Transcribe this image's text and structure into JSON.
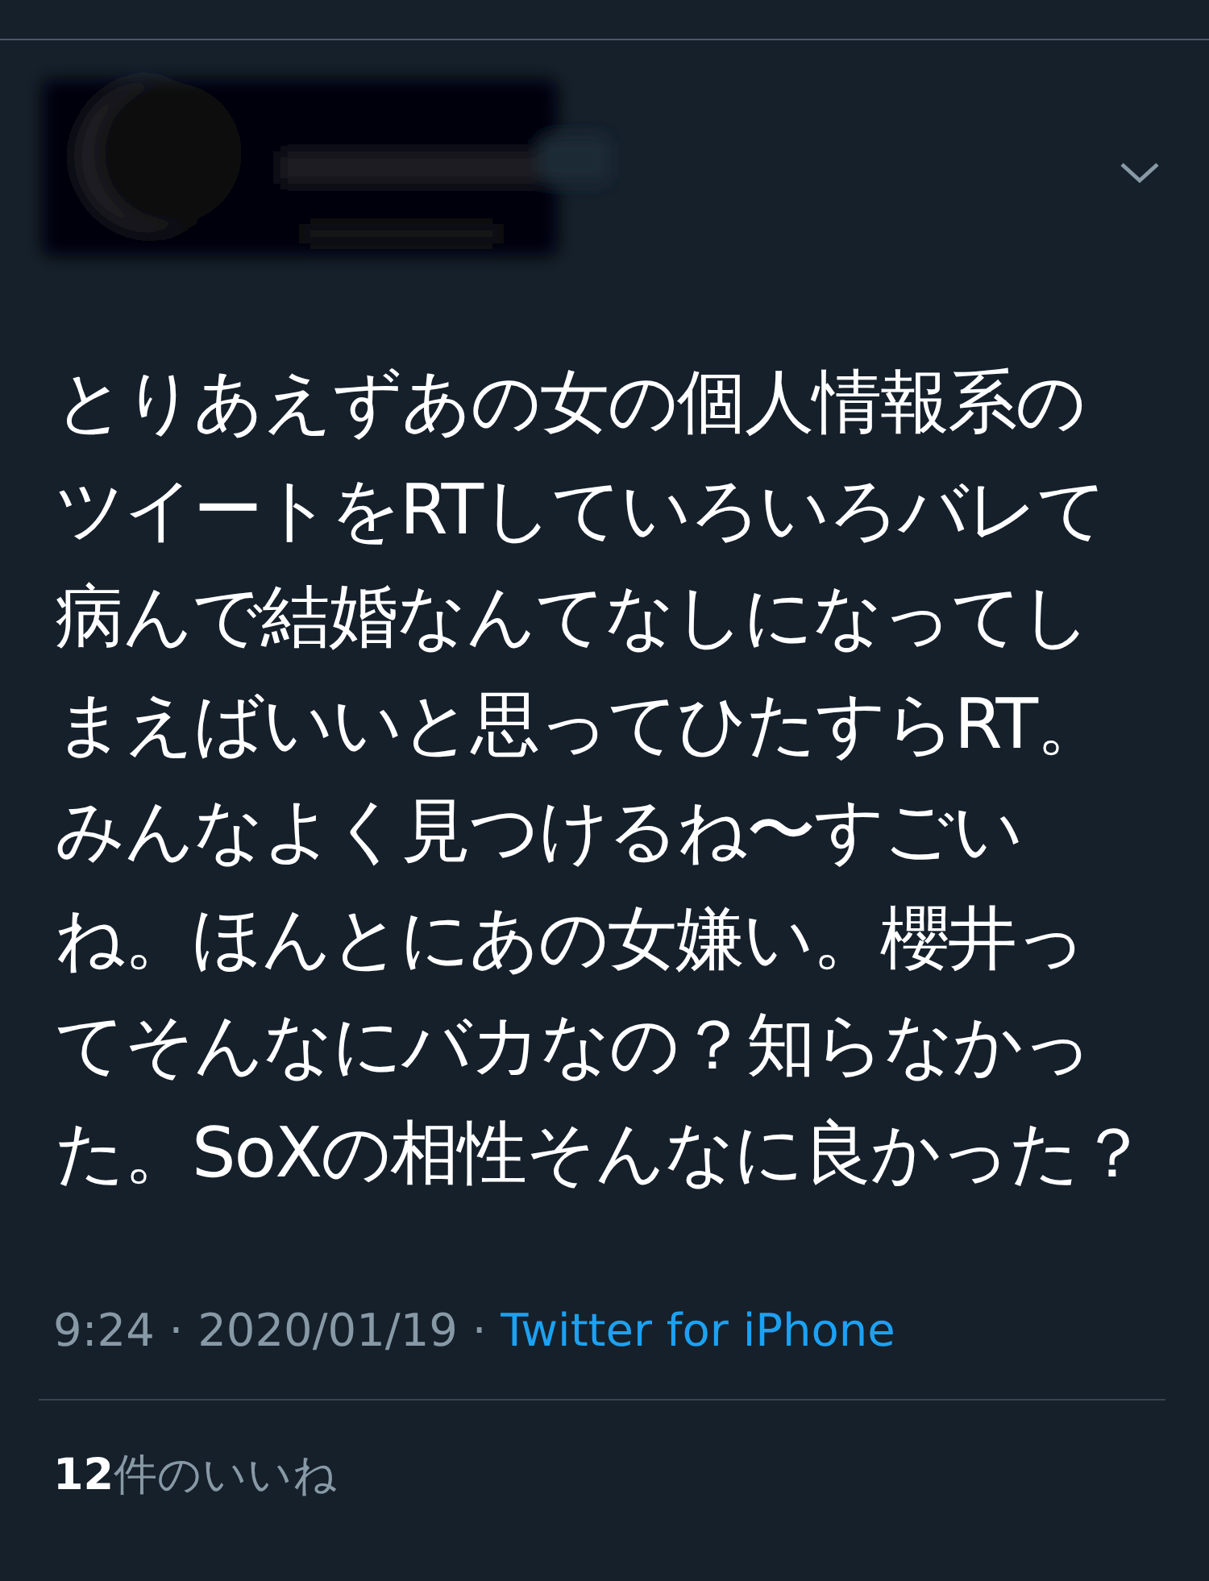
{
  "tweet": {
    "text": "とりあえずあの女の個人情報系のツイートをRTしていろいろバレて病んで結婚なんてなしになってしまえばいいと思ってひたすらRT。みんなよく見つけるね〜すごいね。ほんとにあの女嫌い。櫻井ってそんなにバカなの？知らなかった。SoXの相性そんなに良かった？",
    "meta": "9:24 · 2020/01/19 · ",
    "source": "Twitter for iPhone"
  },
  "likes": "**12**件のいいね"
}
